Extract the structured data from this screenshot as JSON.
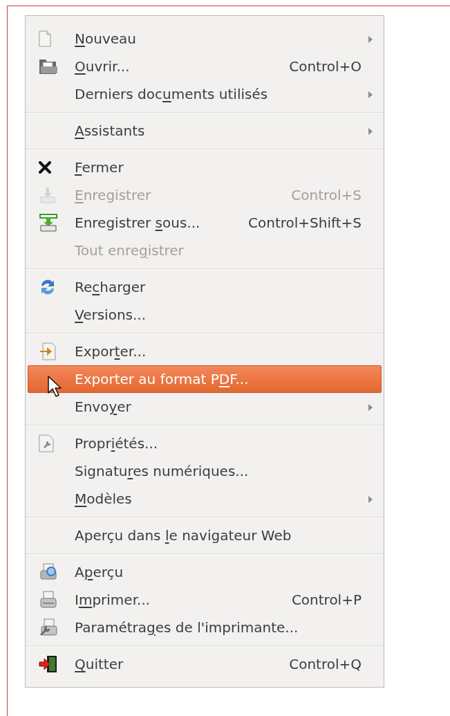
{
  "menu": {
    "sections": [
      {
        "items": [
          {
            "kind": "document",
            "mnemonic": "N",
            "text_after": "ouveau",
            "submenu": true,
            "disabled": false,
            "selected": false
          },
          {
            "kind": "open",
            "mnemonic": "O",
            "text_after": "uvrir...",
            "shortcut": "Control+O",
            "submenu": false,
            "disabled": false,
            "selected": false
          },
          {
            "kind": "plain",
            "text_before": "Derniers doc",
            "mnemonic": "u",
            "text_after": "ments utilisés",
            "submenu": true,
            "disabled": false,
            "selected": false
          }
        ]
      },
      {
        "items": [
          {
            "kind": "plain",
            "mnemonic": "A",
            "text_after": "ssistants",
            "submenu": true,
            "disabled": false,
            "selected": false
          }
        ]
      },
      {
        "items": [
          {
            "kind": "close",
            "mnemonic": "F",
            "text_after": "ermer",
            "submenu": false,
            "disabled": false,
            "selected": false
          },
          {
            "kind": "save",
            "mnemonic": "E",
            "text_after": "nregistrer",
            "shortcut": "Control+S",
            "submenu": false,
            "disabled": true,
            "selected": false
          },
          {
            "kind": "save-as",
            "text_before": "Enregistrer ",
            "mnemonic": "s",
            "text_after": "ous...",
            "shortcut": "Control+Shift+S",
            "submenu": false,
            "disabled": false,
            "selected": false
          },
          {
            "kind": "plain",
            "text_before": "Tout enre",
            "mnemonic": "g",
            "text_after": "istrer",
            "submenu": false,
            "disabled": true,
            "selected": false
          }
        ]
      },
      {
        "items": [
          {
            "kind": "reload",
            "text_before": "Re",
            "mnemonic": "c",
            "text_after": "harger",
            "submenu": false,
            "disabled": false,
            "selected": false
          },
          {
            "kind": "plain",
            "mnemonic": "V",
            "text_after": "ersions...",
            "submenu": false,
            "disabled": false,
            "selected": false
          }
        ]
      },
      {
        "items": [
          {
            "kind": "export",
            "text_before": "Expor",
            "mnemonic": "t",
            "text_after": "er...",
            "submenu": false,
            "disabled": false,
            "selected": false
          },
          {
            "kind": "plain",
            "text_before": "Exporter au format P",
            "mnemonic": "D",
            "text_after": "F...",
            "submenu": false,
            "disabled": false,
            "selected": true
          },
          {
            "kind": "plain",
            "text_before": "Envo",
            "mnemonic": "y",
            "text_after": "er",
            "submenu": true,
            "disabled": false,
            "selected": false
          }
        ]
      },
      {
        "items": [
          {
            "kind": "properties",
            "text_before": "Propr",
            "mnemonic": "i",
            "text_after": "étés...",
            "submenu": false,
            "disabled": false,
            "selected": false
          },
          {
            "kind": "plain",
            "text_before": "Signatu",
            "mnemonic": "r",
            "text_after": "es numériques...",
            "submenu": false,
            "disabled": false,
            "selected": false
          },
          {
            "kind": "plain",
            "mnemonic": "M",
            "text_after": "odèles",
            "submenu": true,
            "disabled": false,
            "selected": false
          }
        ]
      },
      {
        "items": [
          {
            "kind": "plain",
            "text_before": "Aperçu dans ",
            "mnemonic": "l",
            "text_after": "e navigateur Web",
            "submenu": false,
            "disabled": false,
            "selected": false
          }
        ]
      },
      {
        "items": [
          {
            "kind": "preview",
            "text_before": "A",
            "mnemonic": "p",
            "text_after": "erçu",
            "submenu": false,
            "disabled": false,
            "selected": false
          },
          {
            "kind": "print",
            "text_before": "I",
            "mnemonic": "m",
            "text_after": "primer...",
            "shortcut": "Control+P",
            "submenu": false,
            "disabled": false,
            "selected": false
          },
          {
            "kind": "printer-settings",
            "text_before": "Paramétra",
            "mnemonic": "g",
            "text_after": "es de l'imprimante...",
            "submenu": false,
            "disabled": false,
            "selected": false
          }
        ]
      },
      {
        "items": [
          {
            "kind": "quit",
            "mnemonic": "Q",
            "text_after": "uitter",
            "shortcut": "Control+Q",
            "submenu": false,
            "disabled": false,
            "selected": false
          }
        ]
      }
    ]
  }
}
